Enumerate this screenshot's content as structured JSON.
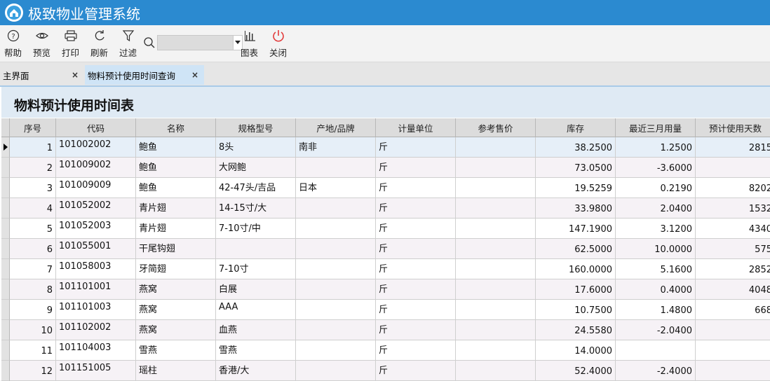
{
  "app": {
    "title": "极致物业管理系统"
  },
  "toolbar": {
    "help": "帮助",
    "preview": "预览",
    "print": "打印",
    "refresh": "刷新",
    "filter": "过滤",
    "search_value": "",
    "chart": "图表",
    "close": "关闭"
  },
  "tabs": {
    "home": "主界面",
    "active": "物料预计使用时间查询",
    "close_symbol": "×"
  },
  "report": {
    "title": "物料预计使用时间表"
  },
  "table": {
    "columns": [
      "序号",
      "代码",
      "名称",
      "规格型号",
      "产地/品牌",
      "计量单位",
      "参考售价",
      "库存",
      "最近三月用量",
      "预计使用天数"
    ],
    "rows": [
      [
        "1",
        "101002002",
        "鲍鱼",
        "8头",
        "南非",
        "斤",
        "",
        "38.2500",
        "1.2500",
        "2815"
      ],
      [
        "2",
        "101009002",
        "鲍鱼",
        "大网鲍",
        "",
        "斤",
        "",
        "73.0500",
        "-3.6000",
        ""
      ],
      [
        "3",
        "101009009",
        "鲍鱼",
        "42-47头/吉品",
        "日本",
        "斤",
        "",
        "19.5259",
        "0.2190",
        "8202"
      ],
      [
        "4",
        "101052002",
        "青片翅",
        "14-15寸/大",
        "",
        "斤",
        "",
        "33.9800",
        "2.0400",
        "1532"
      ],
      [
        "5",
        "101052003",
        "青片翅",
        "7-10寸/中",
        "",
        "斤",
        "",
        "147.1900",
        "3.1200",
        "4340"
      ],
      [
        "6",
        "101055001",
        "干尾钩翅",
        "",
        "",
        "斤",
        "",
        "62.5000",
        "10.0000",
        "575"
      ],
      [
        "7",
        "101058003",
        "牙简翅",
        "7-10寸",
        "",
        "斤",
        "",
        "160.0000",
        "5.1600",
        "2852"
      ],
      [
        "8",
        "101101001",
        "燕窝",
        "白展",
        "",
        "斤",
        "",
        "17.6000",
        "0.4000",
        "4048"
      ],
      [
        "9",
        "101101003",
        "燕窝",
        "AAA",
        "",
        "斤",
        "",
        "10.7500",
        "1.4800",
        "668"
      ],
      [
        "10",
        "101102002",
        "燕窝",
        "血燕",
        "",
        "斤",
        "",
        "24.5580",
        "-2.0400",
        ""
      ],
      [
        "11",
        "101104003",
        "雪燕",
        "雪燕",
        "",
        "斤",
        "",
        "14.0000",
        "",
        ""
      ],
      [
        "12",
        "101151005",
        "瑶柱",
        "香港/大",
        "",
        "斤",
        "",
        "52.4000",
        "-2.4000",
        ""
      ]
    ]
  }
}
